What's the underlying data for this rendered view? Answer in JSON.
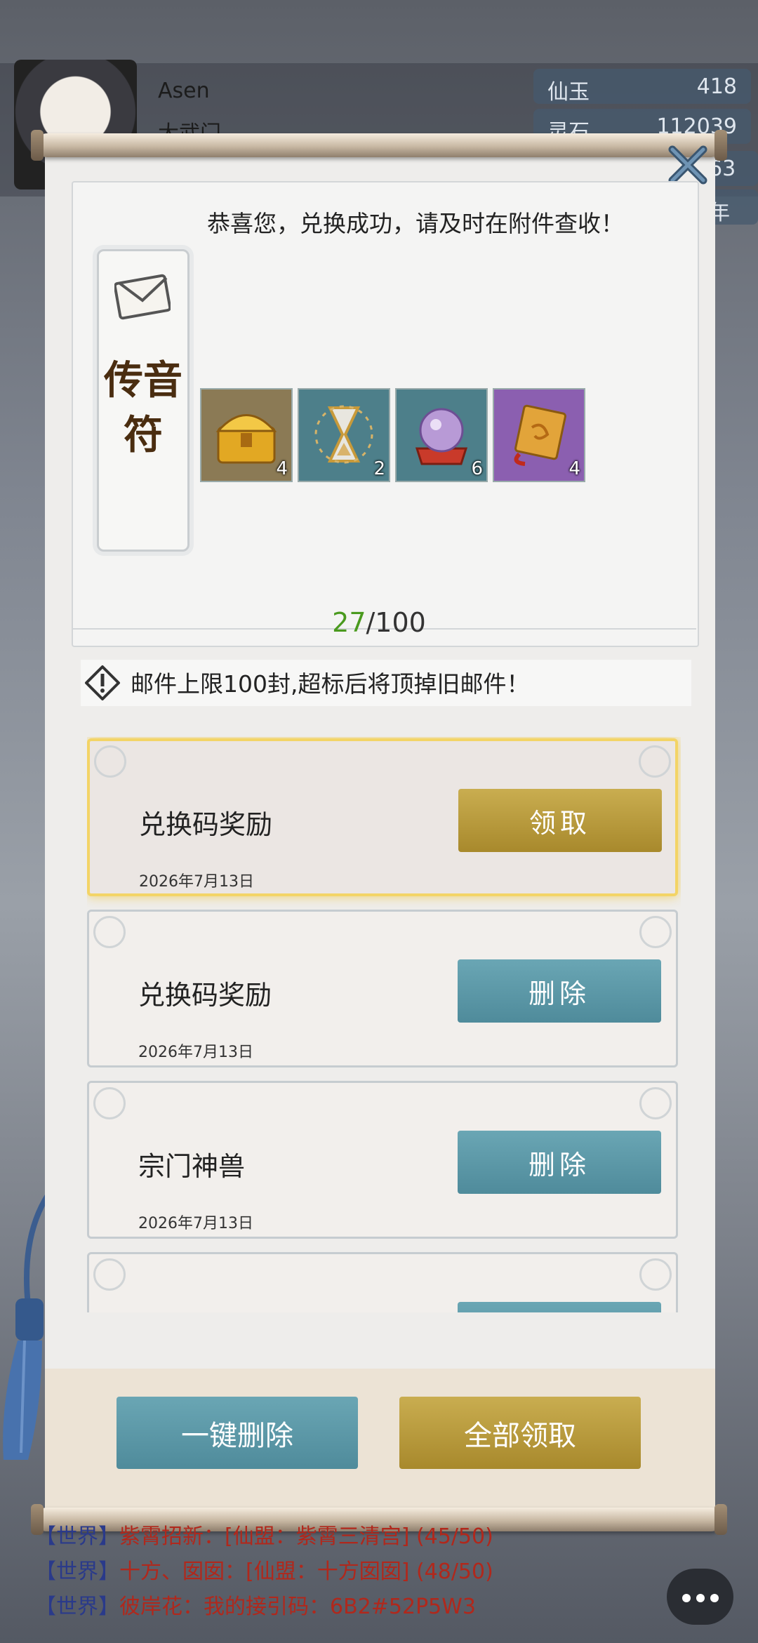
{
  "player": {
    "name": "Asen",
    "sect": "大武门"
  },
  "resources": [
    {
      "label": "仙玉",
      "value": "418"
    },
    {
      "label": "灵石",
      "value": "112039"
    }
  ],
  "resource_extra": [
    "63",
    "年"
  ],
  "mail_panel": {
    "close_icon": "close-icon",
    "talisman_label": "传音符",
    "message": "恭喜您，兑换成功，请及时在附件查收！",
    "attachments": [
      {
        "icon": "treasure-chest-icon",
        "count": "4",
        "bg": "#8b7a55"
      },
      {
        "icon": "hourglass-icon",
        "count": "2",
        "bg": "#4d7f8a"
      },
      {
        "icon": "crystal-orb-icon",
        "count": "6",
        "bg": "#4d7f8a"
      },
      {
        "icon": "scroll-icon",
        "count": "4",
        "bg": "#8b5fb0"
      }
    ],
    "count_current": "27",
    "count_total": "/100",
    "notice": "邮件上限100封,超标后将顶掉旧邮件！",
    "mails": [
      {
        "title": "兑换码奖励",
        "date": "2026年7月13日",
        "button": "领取",
        "state": "unclaimed"
      },
      {
        "title": "兑换码奖励",
        "date": "2026年7月13日",
        "button": "删除",
        "state": "claimed"
      },
      {
        "title": "宗门神兽",
        "date": "2026年7月13日",
        "button": "删除",
        "state": "claimed"
      },
      {
        "title": "",
        "date": "",
        "button": "",
        "state": "claimed"
      }
    ],
    "delete_all": "一键删除",
    "claim_all": "全部领取"
  },
  "chat": [
    {
      "channel": "【世界】",
      "sender": "紫霄招新：",
      "message": "[仙盟：紫霄三清宫] (45/50)"
    },
    {
      "channel": "【世界】",
      "sender": "十方、囡囡：",
      "message": "[仙盟：十方囡囡] (48/50)"
    },
    {
      "channel": "【世界】",
      "sender": "彼岸花：",
      "message": "我的接引码：6B2#52P5W3"
    }
  ],
  "colors": {
    "gold_button": "#b8983c",
    "teal_button": "#5d99a8",
    "count_green": "#4a9a1e",
    "chat_red": "#b0281c"
  }
}
